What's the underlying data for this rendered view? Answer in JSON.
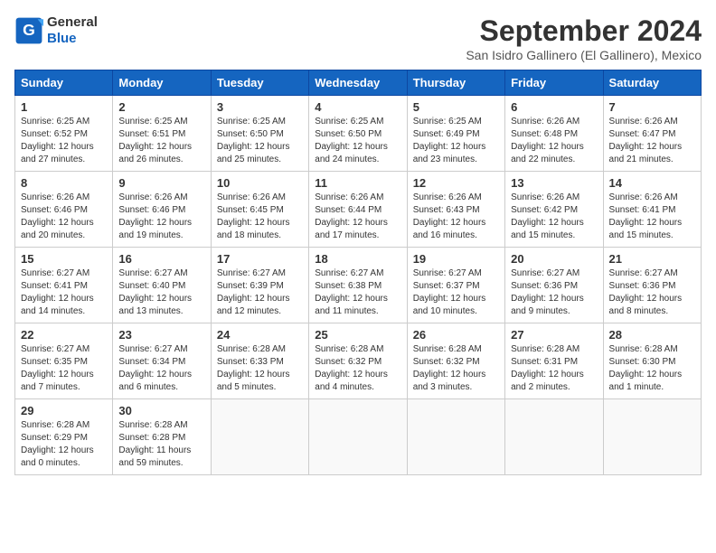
{
  "header": {
    "logo_general": "General",
    "logo_blue": "Blue",
    "month_title": "September 2024",
    "location": "San Isidro Gallinero (El Gallinero), Mexico"
  },
  "days_of_week": [
    "Sunday",
    "Monday",
    "Tuesday",
    "Wednesday",
    "Thursday",
    "Friday",
    "Saturday"
  ],
  "weeks": [
    [
      {
        "day": "1",
        "info": "Sunrise: 6:25 AM\nSunset: 6:52 PM\nDaylight: 12 hours\nand 27 minutes."
      },
      {
        "day": "2",
        "info": "Sunrise: 6:25 AM\nSunset: 6:51 PM\nDaylight: 12 hours\nand 26 minutes."
      },
      {
        "day": "3",
        "info": "Sunrise: 6:25 AM\nSunset: 6:50 PM\nDaylight: 12 hours\nand 25 minutes."
      },
      {
        "day": "4",
        "info": "Sunrise: 6:25 AM\nSunset: 6:50 PM\nDaylight: 12 hours\nand 24 minutes."
      },
      {
        "day": "5",
        "info": "Sunrise: 6:25 AM\nSunset: 6:49 PM\nDaylight: 12 hours\nand 23 minutes."
      },
      {
        "day": "6",
        "info": "Sunrise: 6:26 AM\nSunset: 6:48 PM\nDaylight: 12 hours\nand 22 minutes."
      },
      {
        "day": "7",
        "info": "Sunrise: 6:26 AM\nSunset: 6:47 PM\nDaylight: 12 hours\nand 21 minutes."
      }
    ],
    [
      {
        "day": "8",
        "info": "Sunrise: 6:26 AM\nSunset: 6:46 PM\nDaylight: 12 hours\nand 20 minutes."
      },
      {
        "day": "9",
        "info": "Sunrise: 6:26 AM\nSunset: 6:46 PM\nDaylight: 12 hours\nand 19 minutes."
      },
      {
        "day": "10",
        "info": "Sunrise: 6:26 AM\nSunset: 6:45 PM\nDaylight: 12 hours\nand 18 minutes."
      },
      {
        "day": "11",
        "info": "Sunrise: 6:26 AM\nSunset: 6:44 PM\nDaylight: 12 hours\nand 17 minutes."
      },
      {
        "day": "12",
        "info": "Sunrise: 6:26 AM\nSunset: 6:43 PM\nDaylight: 12 hours\nand 16 minutes."
      },
      {
        "day": "13",
        "info": "Sunrise: 6:26 AM\nSunset: 6:42 PM\nDaylight: 12 hours\nand 15 minutes."
      },
      {
        "day": "14",
        "info": "Sunrise: 6:26 AM\nSunset: 6:41 PM\nDaylight: 12 hours\nand 15 minutes."
      }
    ],
    [
      {
        "day": "15",
        "info": "Sunrise: 6:27 AM\nSunset: 6:41 PM\nDaylight: 12 hours\nand 14 minutes."
      },
      {
        "day": "16",
        "info": "Sunrise: 6:27 AM\nSunset: 6:40 PM\nDaylight: 12 hours\nand 13 minutes."
      },
      {
        "day": "17",
        "info": "Sunrise: 6:27 AM\nSunset: 6:39 PM\nDaylight: 12 hours\nand 12 minutes."
      },
      {
        "day": "18",
        "info": "Sunrise: 6:27 AM\nSunset: 6:38 PM\nDaylight: 12 hours\nand 11 minutes."
      },
      {
        "day": "19",
        "info": "Sunrise: 6:27 AM\nSunset: 6:37 PM\nDaylight: 12 hours\nand 10 minutes."
      },
      {
        "day": "20",
        "info": "Sunrise: 6:27 AM\nSunset: 6:36 PM\nDaylight: 12 hours\nand 9 minutes."
      },
      {
        "day": "21",
        "info": "Sunrise: 6:27 AM\nSunset: 6:36 PM\nDaylight: 12 hours\nand 8 minutes."
      }
    ],
    [
      {
        "day": "22",
        "info": "Sunrise: 6:27 AM\nSunset: 6:35 PM\nDaylight: 12 hours\nand 7 minutes."
      },
      {
        "day": "23",
        "info": "Sunrise: 6:27 AM\nSunset: 6:34 PM\nDaylight: 12 hours\nand 6 minutes."
      },
      {
        "day": "24",
        "info": "Sunrise: 6:28 AM\nSunset: 6:33 PM\nDaylight: 12 hours\nand 5 minutes."
      },
      {
        "day": "25",
        "info": "Sunrise: 6:28 AM\nSunset: 6:32 PM\nDaylight: 12 hours\nand 4 minutes."
      },
      {
        "day": "26",
        "info": "Sunrise: 6:28 AM\nSunset: 6:32 PM\nDaylight: 12 hours\nand 3 minutes."
      },
      {
        "day": "27",
        "info": "Sunrise: 6:28 AM\nSunset: 6:31 PM\nDaylight: 12 hours\nand 2 minutes."
      },
      {
        "day": "28",
        "info": "Sunrise: 6:28 AM\nSunset: 6:30 PM\nDaylight: 12 hours\nand 1 minute."
      }
    ],
    [
      {
        "day": "29",
        "info": "Sunrise: 6:28 AM\nSunset: 6:29 PM\nDaylight: 12 hours\nand 0 minutes."
      },
      {
        "day": "30",
        "info": "Sunrise: 6:28 AM\nSunset: 6:28 PM\nDaylight: 11 hours\nand 59 minutes."
      },
      {
        "day": "",
        "info": ""
      },
      {
        "day": "",
        "info": ""
      },
      {
        "day": "",
        "info": ""
      },
      {
        "day": "",
        "info": ""
      },
      {
        "day": "",
        "info": ""
      }
    ]
  ]
}
